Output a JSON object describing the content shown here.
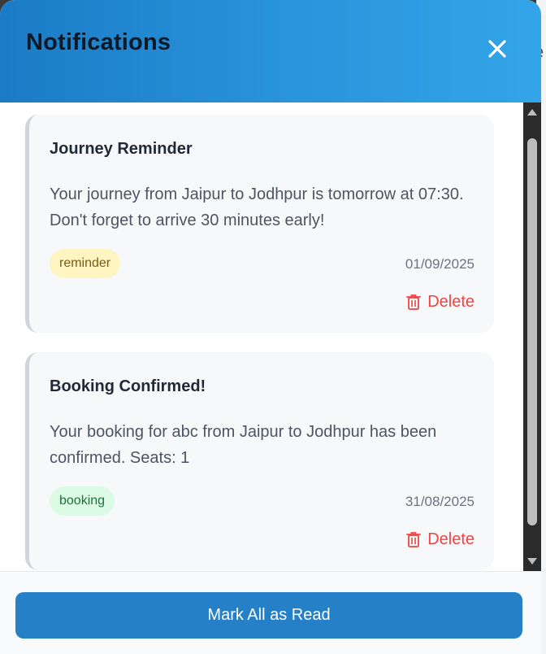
{
  "backdrop": {
    "partial_char": "e"
  },
  "header": {
    "title": "Notifications",
    "close_icon": "close-icon"
  },
  "notifications": [
    {
      "title": "Journey Reminder",
      "message": "Your journey from Jaipur to Jodhpur is tomorrow at 07:30. Don't forget to arrive 30 minutes early!",
      "tag": "reminder",
      "date": "01/09/2025",
      "delete_label": "Delete",
      "delete_icon": "trash-icon"
    },
    {
      "title": "Booking Confirmed!",
      "message": "Your booking for abc from Jaipur to Jodhpur has been confirmed. Seats: 1",
      "tag": "booking",
      "date": "31/08/2025",
      "delete_label": "Delete",
      "delete_icon": "trash-icon"
    }
  ],
  "footer": {
    "mark_all_label": "Mark All as Read"
  },
  "colors": {
    "header_gradient_start": "#1a7cc6",
    "header_gradient_end": "#33a5e8",
    "button": "#2580c7",
    "delete": "#ef4444",
    "tag_reminder_bg": "#fef5c3",
    "tag_booking_bg": "#dcfbe5"
  }
}
